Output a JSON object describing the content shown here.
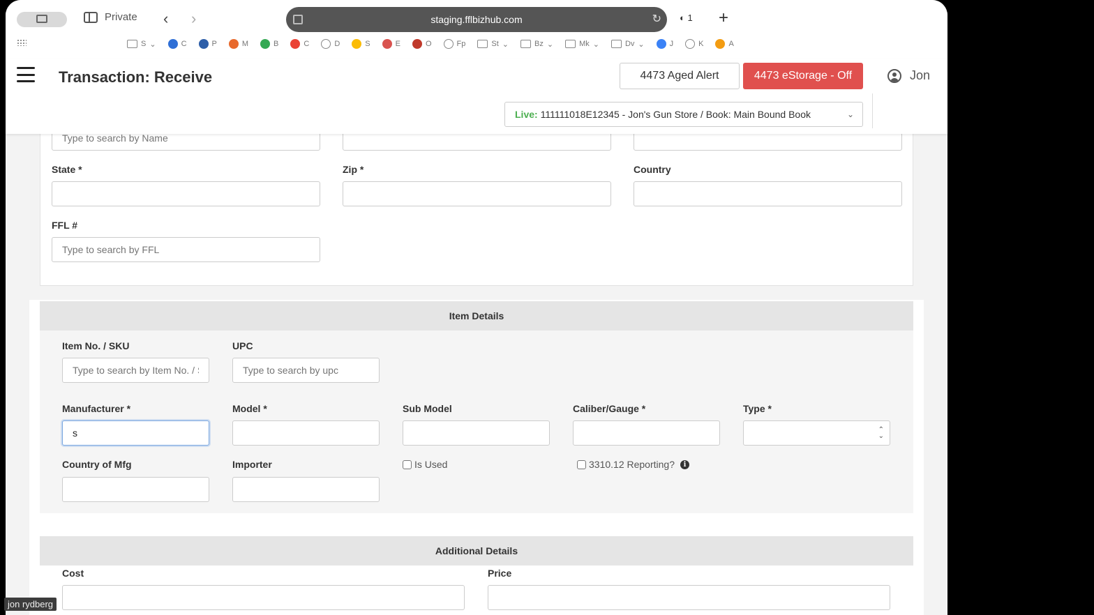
{
  "browser": {
    "private_label": "Private",
    "url": "staging.fflbizhub.com",
    "shield_count": "1",
    "bookmarks": [
      {
        "label": "S",
        "icon": "folder",
        "dropdown": true
      },
      {
        "label": "C",
        "icon": "blue-logo",
        "color": "#2f6fd6"
      },
      {
        "label": "P",
        "icon": "blue-square",
        "color": "#2d5ea8"
      },
      {
        "label": "M",
        "icon": "orange-ring",
        "color": "#e8692c"
      },
      {
        "label": "B",
        "icon": "google-ring",
        "color": "#34a853"
      },
      {
        "label": "C",
        "icon": "google-ring",
        "color": "#ea4335"
      },
      {
        "label": "D",
        "icon": "globe"
      },
      {
        "label": "S",
        "icon": "google-ring",
        "color": "#fbbc05"
      },
      {
        "label": "E",
        "icon": "red-logo",
        "color": "#d9534f"
      },
      {
        "label": "O",
        "icon": "red-person",
        "color": "#c0392b"
      },
      {
        "label": "Fp",
        "icon": "globe"
      },
      {
        "label": "St",
        "icon": "folder",
        "dropdown": true
      },
      {
        "label": "Bz",
        "icon": "folder",
        "dropdown": true
      },
      {
        "label": "Mk",
        "icon": "folder",
        "dropdown": true
      },
      {
        "label": "Dv",
        "icon": "folder",
        "dropdown": true
      },
      {
        "label": "J",
        "icon": "blue-app",
        "color": "#3b82f6"
      },
      {
        "label": "K",
        "icon": "globe"
      },
      {
        "label": "A",
        "icon": "orange-cube",
        "color": "#f39c12"
      }
    ]
  },
  "header": {
    "title": "Transaction: Receive",
    "aged_alert_label": "4473 Aged Alert",
    "estorage_label": "4473 eStorage - Off",
    "estorage_color": "#e0504e",
    "user_name": "Jon",
    "book_live_label": "Live:",
    "book_value": "111111018E12345 - Jon's Gun Store / Book: Main Bound Book"
  },
  "source_form": {
    "name_placeholder": "Type to search by Name",
    "state_label": "State *",
    "zip_label": "Zip *",
    "country_label": "Country",
    "ffl_label": "FFL #",
    "ffl_placeholder": "Type to search by FFL"
  },
  "item_details": {
    "heading": "Item Details",
    "sku_label": "Item No. / SKU",
    "sku_placeholder": "Type to search by Item No. / SKU",
    "upc_label": "UPC",
    "upc_placeholder": "Type to search by upc",
    "manufacturer_label": "Manufacturer *",
    "manufacturer_value": "s",
    "model_label": "Model *",
    "submodel_label": "Sub Model",
    "caliber_label": "Caliber/Gauge *",
    "type_label": "Type *",
    "country_mfg_label": "Country of Mfg",
    "importer_label": "Importer",
    "is_used_label": "Is Used",
    "reporting_label": "3310.12 Reporting?"
  },
  "additional_details": {
    "heading": "Additional Details",
    "cost_label": "Cost",
    "price_label": "Price"
  },
  "overlay": {
    "presenter_name": "jon rydberg"
  }
}
